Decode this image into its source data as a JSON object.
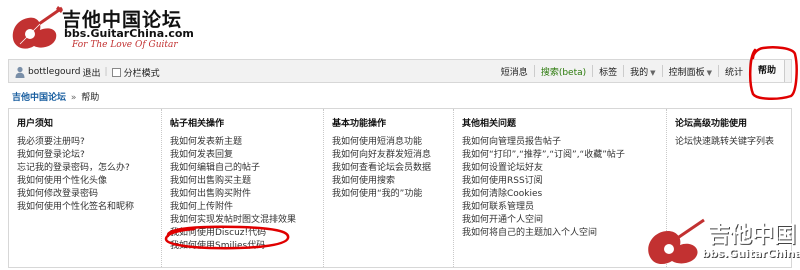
{
  "site": {
    "title": "吉他中国论坛",
    "url": "bbs.GuitarChina.com",
    "slogan": "For The Love Of Guitar",
    "brand_color": "#c23131"
  },
  "topbar": {
    "username": "bottlegourd",
    "logout": "退出",
    "layout_toggle": "分栏模式",
    "nav": {
      "sms": "短消息",
      "search": "搜索(beta)",
      "tags": "标签",
      "mine": "我的",
      "control_panel": "控制面板",
      "stats": "统计",
      "help": "帮助"
    }
  },
  "breadcrumb": {
    "home": "吉他中国论坛",
    "separator": "»",
    "current": "帮助"
  },
  "help_columns": [
    {
      "title": "用户须知",
      "items": [
        "我必须要注册吗?",
        "我如何登录论坛?",
        "忘记我的登录密码，怎么办?",
        "我如何使用个性化头像",
        "我如何修改登录密码",
        "我如何使用个性化签名和昵称"
      ]
    },
    {
      "title": "帖子相关操作",
      "items": [
        "我如何发表新主题",
        "我如何发表回复",
        "我如何编辑自己的帖子",
        "我如何出售购买主题",
        "我如何出售购买附件",
        "我如何上传附件",
        "我如何实现发帖时图文混排效果",
        "我如何使用Discuz!代码",
        "我如何使用Smilies代码"
      ]
    },
    {
      "title": "基本功能操作",
      "items": [
        "我如何使用短消息功能",
        "我如何向好友群发短消息",
        "我如何查看论坛会员数据",
        "我如何使用搜索",
        "我如何使用“我的”功能"
      ]
    },
    {
      "title": "其他相关问题",
      "items": [
        "我如何向管理员报告帖子",
        "我如何“打印”,“推荐”,“订阅”,“收藏”帖子",
        "我如何设置论坛好友",
        "我如何使用RSS订阅",
        "我如何清除Cookies",
        "我如何联系管理员",
        "我如何开通个人空间",
        "我如何将自己的主题加入个人空间"
      ]
    },
    {
      "title": "论坛高级功能使用",
      "items": [
        "论坛快速跳转关键字列表"
      ]
    }
  ],
  "watermark": {
    "title": "吉他中国",
    "url": "bbs.GuitarChina.com"
  },
  "annotation_color": "#e00000"
}
